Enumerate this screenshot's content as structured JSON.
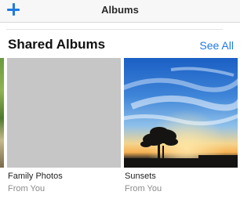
{
  "navbar": {
    "title": "Albums",
    "add_icon": "plus-icon"
  },
  "section": {
    "title": "Shared Albums",
    "see_all": "See All"
  },
  "albums": [
    {
      "name": "Family Photos",
      "subtitle": "From You"
    },
    {
      "name": "Sunsets",
      "subtitle": "From You"
    }
  ],
  "colors": {
    "accent": "#1f7be0",
    "placeholder": "#c6c6c6",
    "secondary_text": "#8b8b8b"
  }
}
